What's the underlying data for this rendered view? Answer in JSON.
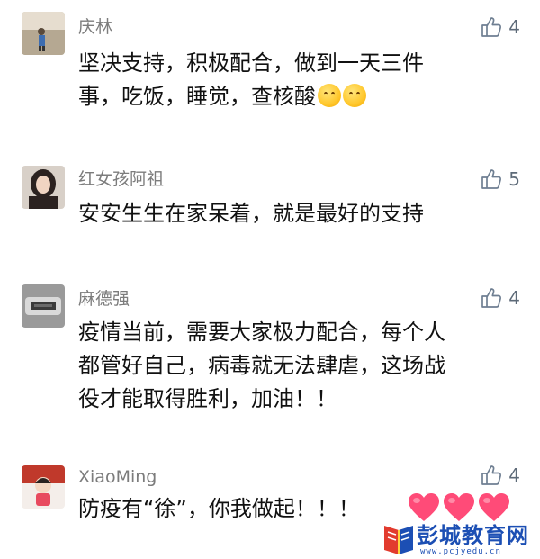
{
  "comments": [
    {
      "name": "庆林",
      "likes": "4",
      "lines": [
        "坚决支持，积极配合，做到一天三件",
        "事，吃饭，睡觉，查核酸"
      ],
      "emoji": "hugging-face-emoji"
    },
    {
      "name": "红女孩阿祖",
      "likes": "5",
      "lines": [
        "安安生生在家呆着，就是最好的支持"
      ]
    },
    {
      "name": "麻德强",
      "likes": "4",
      "lines": [
        "疫情当前，需要大家极力配合，每个人",
        "都管好自己，病毒就无法肆虐，这场战",
        "役才能取得胜利，加油！！"
      ]
    },
    {
      "name": "XiaoMing",
      "likes": "4",
      "lines": [
        "防疫有“徐”，你我做起！！！"
      ]
    }
  ],
  "watermark": {
    "title": "彭城教育网",
    "url": "www.pcjyedu.cn",
    "heart_color": "#ff4b78",
    "brand_color": "#1c4fb4"
  },
  "icons": {
    "like": "thumbs-up-icon",
    "heart": "heart-icon"
  }
}
